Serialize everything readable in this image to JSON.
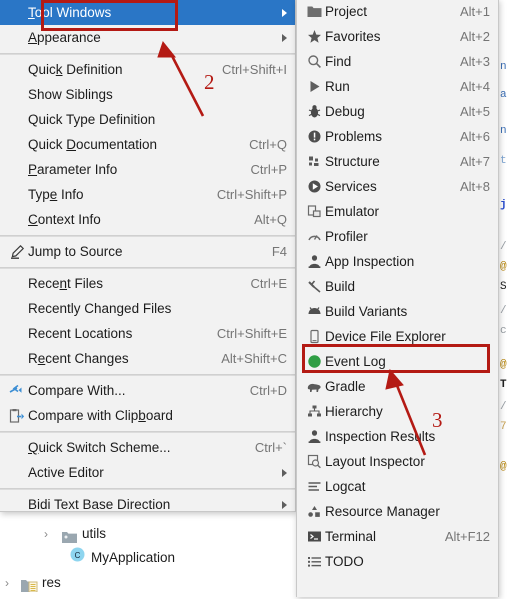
{
  "app": {
    "theme_bg": "#f2f2f2",
    "accent_selected": "#2a76c6",
    "annotation_color": "#b41a14"
  },
  "main_menu": {
    "name": "view-menu",
    "groups": [
      {
        "items": [
          {
            "id": "tool-windows",
            "label": "Tool Windows",
            "mnemonic": "T",
            "accel": "",
            "submenu": true,
            "selected": true,
            "icon": ""
          },
          {
            "id": "appearance",
            "label": "Appearance",
            "mnemonic": "A",
            "accel": "",
            "submenu": true,
            "selected": false,
            "icon": ""
          }
        ]
      },
      {
        "items": [
          {
            "id": "quick-definition",
            "label": "Quick Definition",
            "mnemonic": "k",
            "accel": "Ctrl+Shift+I",
            "submenu": false,
            "selected": false,
            "icon": ""
          },
          {
            "id": "show-siblings",
            "label": "Show Siblings",
            "mnemonic": "",
            "accel": "",
            "submenu": false,
            "selected": false,
            "icon": ""
          },
          {
            "id": "quick-type-definition",
            "label": "Quick Type Definition",
            "mnemonic": "",
            "accel": "",
            "submenu": false,
            "selected": false,
            "icon": ""
          },
          {
            "id": "quick-documentation",
            "label": "Quick Documentation",
            "mnemonic": "D",
            "accel": "Ctrl+Q",
            "submenu": false,
            "selected": false,
            "icon": ""
          },
          {
            "id": "parameter-info",
            "label": "Parameter Info",
            "mnemonic": "P",
            "accel": "Ctrl+P",
            "submenu": false,
            "selected": false,
            "icon": ""
          },
          {
            "id": "type-info",
            "label": "Type Info",
            "mnemonic": "e",
            "accel": "Ctrl+Shift+P",
            "submenu": false,
            "selected": false,
            "icon": ""
          },
          {
            "id": "context-info",
            "label": "Context Info",
            "mnemonic": "C",
            "accel": "Alt+Q",
            "submenu": false,
            "selected": false,
            "icon": ""
          }
        ]
      },
      {
        "items": [
          {
            "id": "jump-to-source",
            "label": "Jump to Source",
            "mnemonic": "",
            "accel": "F4",
            "submenu": false,
            "selected": false,
            "icon": "pencil-icon"
          }
        ]
      },
      {
        "items": [
          {
            "id": "recent-files",
            "label": "Recent Files",
            "mnemonic": "n",
            "accel": "Ctrl+E",
            "submenu": false,
            "selected": false,
            "icon": ""
          },
          {
            "id": "recently-changed-files",
            "label": "Recently Changed Files",
            "mnemonic": "",
            "accel": "",
            "submenu": false,
            "selected": false,
            "icon": ""
          },
          {
            "id": "recent-locations",
            "label": "Recent Locations",
            "mnemonic": "",
            "accel": "Ctrl+Shift+E",
            "submenu": false,
            "selected": false,
            "icon": ""
          },
          {
            "id": "recent-changes",
            "label": "Recent Changes",
            "mnemonic": "e",
            "accel": "Alt+Shift+C",
            "submenu": false,
            "selected": false,
            "icon": ""
          }
        ]
      },
      {
        "items": [
          {
            "id": "compare-with",
            "label": "Compare With...",
            "mnemonic": "",
            "accel": "Ctrl+D",
            "submenu": false,
            "selected": false,
            "icon": "compare-icon"
          },
          {
            "id": "compare-with-clipboard",
            "label": "Compare with Clipboard",
            "mnemonic": "b",
            "accel": "",
            "submenu": false,
            "selected": false,
            "icon": "clipboard-compare-icon"
          }
        ]
      },
      {
        "items": [
          {
            "id": "quick-switch-scheme",
            "label": "Quick Switch Scheme...",
            "mnemonic": "Q",
            "accel": "Ctrl+`",
            "submenu": false,
            "selected": false,
            "icon": ""
          },
          {
            "id": "active-editor",
            "label": "Active Editor",
            "mnemonic": "",
            "accel": "",
            "submenu": true,
            "selected": false,
            "icon": ""
          }
        ]
      },
      {
        "items": [
          {
            "id": "bidi-text-base-direction",
            "label": "Bidi Text Base Direction",
            "mnemonic": "",
            "accel": "",
            "submenu": true,
            "selected": false,
            "icon": ""
          }
        ]
      }
    ]
  },
  "sub_menu": {
    "name": "tool-windows-submenu",
    "items": [
      {
        "id": "project",
        "label": "Project",
        "accel": "Alt+1",
        "icon": "folder-icon",
        "highlighted": false
      },
      {
        "id": "favorites",
        "label": "Favorites",
        "accel": "Alt+2",
        "icon": "star-icon",
        "highlighted": false
      },
      {
        "id": "find",
        "label": "Find",
        "accel": "Alt+3",
        "icon": "search-icon",
        "highlighted": false
      },
      {
        "id": "run",
        "label": "Run",
        "accel": "Alt+4",
        "icon": "play-icon",
        "highlighted": false
      },
      {
        "id": "debug",
        "label": "Debug",
        "accel": "Alt+5",
        "icon": "bug-icon",
        "highlighted": false
      },
      {
        "id": "problems",
        "label": "Problems",
        "accel": "Alt+6",
        "icon": "exclamation-circle-icon",
        "highlighted": false
      },
      {
        "id": "structure",
        "label": "Structure",
        "accel": "Alt+7",
        "icon": "structure-icon",
        "highlighted": false
      },
      {
        "id": "services",
        "label": "Services",
        "accel": "Alt+8",
        "icon": "services-icon",
        "highlighted": false
      },
      {
        "id": "emulator",
        "label": "Emulator",
        "accel": "",
        "icon": "emulator-icon",
        "highlighted": false
      },
      {
        "id": "profiler",
        "label": "Profiler",
        "accel": "",
        "icon": "gauge-icon",
        "highlighted": false
      },
      {
        "id": "app-inspection",
        "label": "App Inspection",
        "accel": "",
        "icon": "inspection-icon",
        "highlighted": false
      },
      {
        "id": "build",
        "label": "Build",
        "accel": "",
        "icon": "hammer-icon",
        "highlighted": false
      },
      {
        "id": "build-variants",
        "label": "Build Variants",
        "accel": "",
        "icon": "android-icon",
        "highlighted": false
      },
      {
        "id": "device-file-explorer",
        "label": "Device File Explorer",
        "accel": "",
        "icon": "phone-icon",
        "highlighted": true
      },
      {
        "id": "event-log",
        "label": "Event Log",
        "accel": "",
        "icon": "green-circle-icon",
        "highlighted": false
      },
      {
        "id": "gradle",
        "label": "Gradle",
        "accel": "",
        "icon": "elephant-icon",
        "highlighted": false
      },
      {
        "id": "hierarchy",
        "label": "Hierarchy",
        "accel": "",
        "icon": "hierarchy-icon",
        "highlighted": false
      },
      {
        "id": "inspection-results",
        "label": "Inspection Results",
        "accel": "",
        "icon": "inspection-icon",
        "highlighted": false
      },
      {
        "id": "layout-inspector",
        "label": "Layout Inspector",
        "accel": "",
        "icon": "layout-inspector-icon",
        "highlighted": false
      },
      {
        "id": "logcat",
        "label": "Logcat",
        "accel": "",
        "icon": "logcat-icon",
        "highlighted": false
      },
      {
        "id": "resource-manager",
        "label": "Resource Manager",
        "accel": "",
        "icon": "resource-manager-icon",
        "highlighted": false
      },
      {
        "id": "terminal",
        "label": "Terminal",
        "accel": "Alt+F12",
        "icon": "terminal-icon",
        "highlighted": false
      },
      {
        "id": "todo",
        "label": "TODO",
        "accel": "",
        "icon": "todo-icon",
        "highlighted": false
      }
    ]
  },
  "project_tree": [
    {
      "id": "utils",
      "label": "utils",
      "icon": "folder-icon",
      "expander": "›",
      "indent": 2
    },
    {
      "id": "myapplication",
      "label": "MyApplication",
      "icon": "class-icon",
      "expander": "",
      "indent": 3
    },
    {
      "id": "res",
      "label": "res",
      "icon": "res-folder-icon",
      "expander": "›",
      "indent": 0
    }
  ],
  "annotations": {
    "step2": "2",
    "step3": "3",
    "box_step1_target": "Tool Windows",
    "box_step3_target": "Device File Explorer"
  }
}
